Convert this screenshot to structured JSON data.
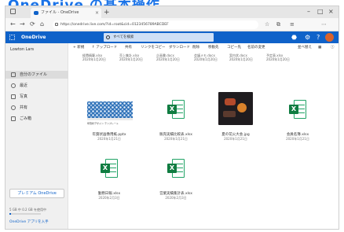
{
  "page_heading": "OneDrive の基本操作",
  "browser": {
    "tab_title": "ファイル - OneDrive",
    "tab_close": "×",
    "new_tab": "+",
    "window_controls": [
      "–",
      "□",
      "×"
    ],
    "nav": [
      "←",
      "→",
      "⟳",
      "⌂"
    ],
    "url": "https://onedrive.live.com/?id=root&cid=0123456789ABCDEF",
    "toolbar_icons": [
      "☆",
      "⧉",
      "≡",
      "⋯"
    ]
  },
  "onedrive": {
    "app_title": "OneDrive",
    "search_placeholder": "すべてを検索",
    "header_icons": [
      "⬣",
      "⚙",
      "?"
    ]
  },
  "sidebar": {
    "user": "Lowton Lars",
    "items": [
      {
        "label": "自分のファイル",
        "icon": "folder-icon",
        "active": true
      },
      {
        "label": "最近",
        "icon": "clock-icon",
        "active": false
      },
      {
        "label": "写真",
        "icon": "photo-icon",
        "active": false
      },
      {
        "label": "共有",
        "icon": "share-icon",
        "active": false
      },
      {
        "label": "ごみ箱",
        "icon": "trash-icon",
        "active": false
      }
    ],
    "premium_label": "プレミアム OneDrive",
    "storage_text": "5 GB 中 0.2 GB を使用中",
    "storage_fraction": 0.04,
    "get_apps": "OneDrive アプリを入手"
  },
  "command_bar": {
    "new": "+ 新規",
    "upload": "↑ アップロード",
    "share": "共有",
    "link": "リンクをコピー",
    "download": "ダウンロード",
    "delete": "削除",
    "move": "移動先",
    "copy": "コピー先",
    "rename": "名前の変更",
    "sort": "並べ替え",
    "view": "▦",
    "info": "ⓘ"
  },
  "top_row_labels": [
    {
      "name": "経費精算.xlsx",
      "date": "2020年1月20日"
    },
    {
      "name": "売上集計.xlsx",
      "date": "2020年1月20日"
    },
    {
      "name": "企画書.docx",
      "date": "2020年1月20日"
    },
    {
      "name": "会議メモ.docx",
      "date": "2020年1月20日"
    },
    {
      "name": "案内状.docx",
      "date": "2020年1月20日"
    },
    {
      "name": "予定表.xlsx",
      "date": "2020年1月20日"
    }
  ],
  "files": [
    {
      "name": "年賀状画像用紙.pptx",
      "date": "2020年1月21日",
      "type": "lace",
      "caption": "年賀状デザイン テンプレート"
    },
    {
      "name": "販売実績比較表.xlsx",
      "date": "2020年1月21日",
      "type": "excel"
    },
    {
      "name": "夏の花火大会.jpg",
      "date": "2020年1月21日",
      "type": "photo"
    },
    {
      "name": "会員名簿.xlsx",
      "date": "2020年1月21日",
      "type": "excel"
    },
    {
      "name": "勤務日報.xlsx",
      "date": "2020年2月3日",
      "type": "excel"
    },
    {
      "name": "営業実績集計表.xlsx",
      "date": "2020年2月3日",
      "type": "excel"
    }
  ]
}
